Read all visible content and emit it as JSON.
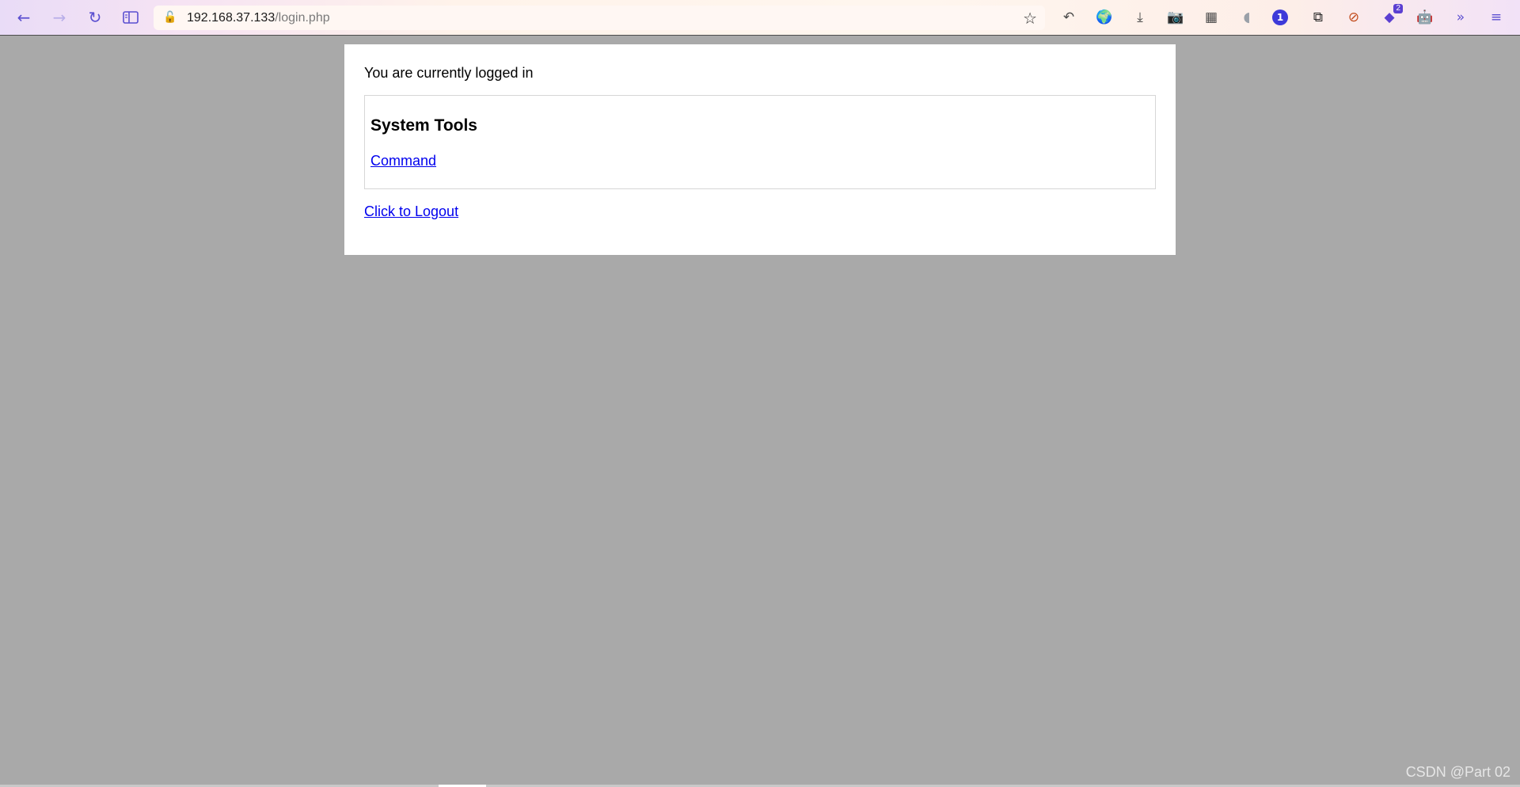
{
  "browser": {
    "url_host": "192.168.37.133",
    "url_path": "/login.php",
    "icons": {
      "back": "arrow-left-icon",
      "forward": "arrow-right-icon",
      "reload": "reload-icon",
      "sidebar": "sidebar-icon",
      "lock": "insecure-lock-icon",
      "bookmark": "star-icon"
    },
    "extensions": [
      {
        "name": "undo-extension-icon",
        "glyph": "↶"
      },
      {
        "name": "globe-extension-icon",
        "glyph": "🌍"
      },
      {
        "name": "download-icon",
        "glyph": "⤓"
      },
      {
        "name": "camera-icon",
        "glyph": "📷"
      },
      {
        "name": "spy-extension-icon",
        "glyph": "▦"
      },
      {
        "name": "shield-extension-icon",
        "glyph": "◖"
      },
      {
        "name": "onepassword-extension-icon",
        "glyph": "1"
      },
      {
        "name": "copy-extension-icon",
        "glyph": "⧉"
      },
      {
        "name": "block-extension-icon",
        "glyph": "⊘"
      },
      {
        "name": "layers-extension-icon",
        "glyph": "◆",
        "badge": "2"
      },
      {
        "name": "robot-extension-icon",
        "glyph": "🤖"
      },
      {
        "name": "overflow-chevrons-icon",
        "glyph": "»"
      },
      {
        "name": "menu-hamburger-icon",
        "glyph": "≡"
      }
    ],
    "accent_color": "#5b4fd0"
  },
  "page": {
    "status_text": "You are currently logged in",
    "tools_title": "System Tools",
    "command_link": "Command",
    "logout_link": "Click to Logout",
    "background_color": "#a9a9a9",
    "link_color": "#0000ee"
  },
  "watermark": "CSDN @Part 02"
}
